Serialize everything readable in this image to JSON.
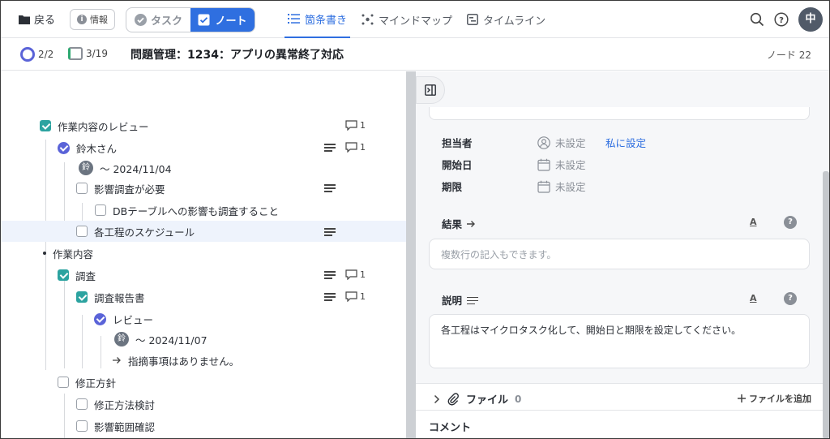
{
  "topbar": {
    "back_label": "戻る",
    "info_label": "情報",
    "seg_task": "タスク",
    "seg_note": "ノート",
    "views": [
      {
        "label": "箇条書き",
        "icon": "list-icon",
        "active": true
      },
      {
        "label": "マインドマップ",
        "icon": "mindmap-icon",
        "active": false
      },
      {
        "label": "タイムライン",
        "icon": "timeline-icon",
        "active": false
      }
    ],
    "avatar": "中"
  },
  "subbar": {
    "progress_circle": "2/2",
    "progress_box": "3/19",
    "title": "問題管理：1234：アプリの異常終了対応",
    "node_count": "ノード 22"
  },
  "outline": [
    {
      "id": "r1",
      "text": "作業内容のレビュー",
      "marker": "checkbox-checked",
      "comments": "1"
    },
    {
      "id": "r2",
      "text": "鈴木さん",
      "marker": "circle-check",
      "comments": "1",
      "memo": true
    },
    {
      "id": "r3",
      "text": "～ 2024/11/04",
      "marker": "avatar",
      "avatar": "鈴"
    },
    {
      "id": "r4",
      "text": "影響調査が必要",
      "marker": "checkbox",
      "memo": true
    },
    {
      "id": "r5",
      "text": "DBテーブルへの影響も調査すること",
      "marker": "checkbox"
    },
    {
      "id": "r6",
      "text": "各工程のスケジュール",
      "marker": "checkbox",
      "memo": true
    },
    {
      "id": "r7",
      "text": "作業内容",
      "marker": "bullet"
    },
    {
      "id": "r8",
      "text": "調査",
      "marker": "checkbox-checked",
      "comments": "1",
      "memo": true
    },
    {
      "id": "r9",
      "text": "調査報告書",
      "marker": "checkbox-checked",
      "comments": "1",
      "memo": true
    },
    {
      "id": "r10",
      "text": "レビュー",
      "marker": "circle-check"
    },
    {
      "id": "r11",
      "text": "～ 2024/11/07",
      "marker": "avatar",
      "avatar": "鈴"
    },
    {
      "id": "r12",
      "text": "指摘事項はありません。",
      "marker": "arrow"
    },
    {
      "id": "r13",
      "text": "修正方針",
      "marker": "checkbox"
    },
    {
      "id": "r14",
      "text": "修正方法検討",
      "marker": "checkbox"
    },
    {
      "id": "r15",
      "text": "影響範囲確認",
      "marker": "checkbox"
    }
  ],
  "detail": {
    "assignee_label": "担当者",
    "assignee_value": "未設定",
    "assign_me": "私に設定",
    "start_label": "開始日",
    "start_value": "未設定",
    "due_label": "期限",
    "due_value": "未設定",
    "result_label": "結果",
    "result_placeholder": "複数行の記入もできます。",
    "desc_label": "説明",
    "desc_text": "各工程はマイクロタスク化して、開始日と期限を設定してください。",
    "text_tool": "A",
    "help": "?",
    "file_label": "ファイル",
    "file_count": "0",
    "add_file": "ファイルを追加",
    "comment_label": "コメント"
  },
  "colors": {
    "accent": "#2f6fe0",
    "check": "#2ca3a0",
    "circle": "#5a63d8"
  }
}
